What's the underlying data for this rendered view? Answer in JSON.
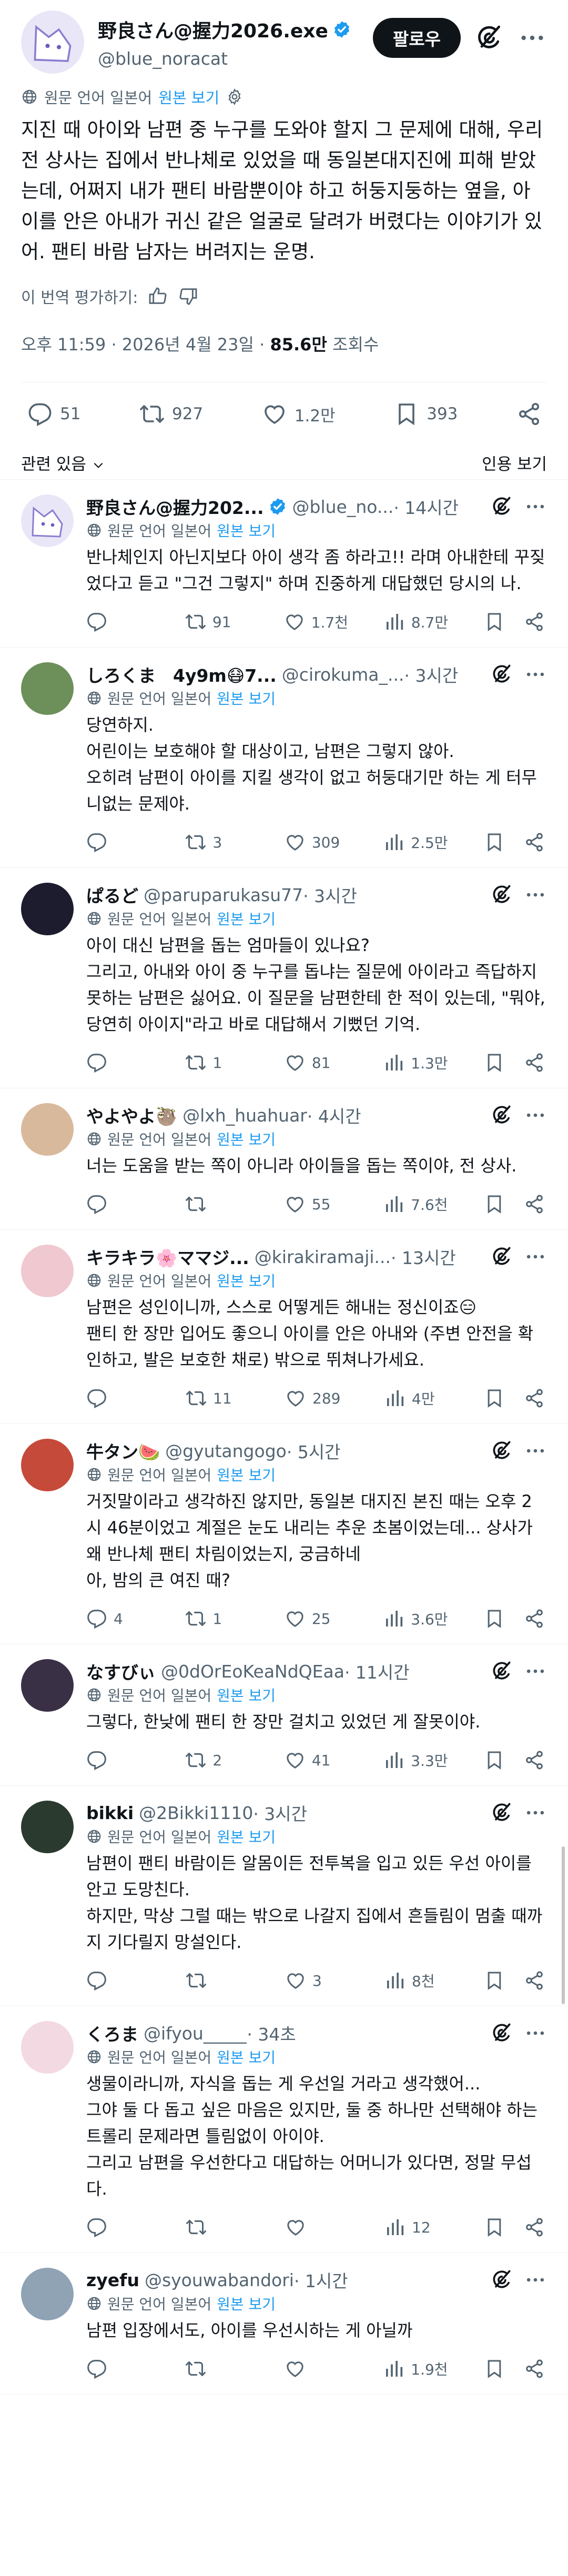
{
  "post": {
    "author_name": "野良さん@握力2026.exe",
    "handle": "@blue_noracat",
    "follow_label": "팔로우",
    "original_lang_label": "원문 언어 일본어",
    "view_original_label": "원본 보기",
    "text": "지진 때 아이와 남편 중 누구를 도와야 할지 그 문제에 대해, 우리 전 상사는 집에서 반나체로 있었을 때 동일본대지진에 피해 받았는데, 어쩌지 내가 팬티 바람뿐이야 하고 허둥지둥하는 옆을, 아이를 안은 아내가 귀신 같은 얼굴로 달려가 버렸다는 이야기가 있어. 팬티 바람 남자는 버려지는 운명.",
    "rate_label": "이 번역 평가하기:",
    "time": "오후 11:59 · 2026년 4월 23일 · ",
    "views": "85.6만",
    "views_label": " 조회수",
    "replies": "51",
    "reposts": "927",
    "likes": "1.2만",
    "bookmarks": "393",
    "relevance_label": "관련 있음",
    "quotes_label": "인용 보기"
  },
  "replies": [
    {
      "name": "野良さん@握力202...",
      "handle": "@blue_no...",
      "time": " · 14시간",
      "verified": true,
      "lang": "원문 언어 일본어",
      "view_original": "원본 보기",
      "text": "반나체인지 아닌지보다 아이 생각 좀 하라고!! 라며 아내한테 꾸짖었다고 듣고 \"그건 그렇지\" 하며 진중하게 대답했던 당시의 나.",
      "replies": "",
      "reposts": "91",
      "likes": "1.7천",
      "views": "8.7만"
    },
    {
      "name": "しろくま　4y9m😷7...",
      "handle": "@cirokuma_...",
      "time": " · 3시간",
      "lang": "원문 언어 일본어",
      "view_original": "원본 보기",
      "text": "당연하지.\n어린이는 보호해야 할 대상이고, 남편은 그렇지 않아.\n오히려 남편이 아이를 지킬 생각이 없고 허둥대기만 하는 게 터무니없는 문제야.",
      "replies": "",
      "reposts": "3",
      "likes": "309",
      "views": "2.5만"
    },
    {
      "name": "ぱるど",
      "handle": "@paruparukasu77",
      "time": " · 3시간",
      "lang": "원문 언어 일본어",
      "view_original": "원본 보기",
      "text": "아이 대신 남편을 돕는 엄마들이 있나요?\n그리고, 아내와 아이 중 누구를 돕냐는 질문에 아이라고 즉답하지 못하는 남편은 싫어요. 이 질문을 남편한테 한 적이 있는데, \"뭐야, 당연히 아이지\"라고 바로 대답해서 기뻤던 기억.",
      "replies": "",
      "reposts": "1",
      "likes": "81",
      "views": "1.3만"
    },
    {
      "name": "やよやよ🦥",
      "handle": "@lxh_huahuar",
      "time": " · 4시간",
      "lang": "원문 언어 일본어",
      "view_original": "원본 보기",
      "text": "너는 도움을 받는 쪽이 아니라 아이들을 돕는 쪽이야, 전 상사.",
      "replies": "",
      "reposts": "",
      "likes": "55",
      "views": "7.6천"
    },
    {
      "name": "キラキラ🌸ママジ...",
      "handle": "@kirakiramaji...",
      "time": " · 13시간",
      "lang": "원문 언어 일본어",
      "view_original": "원본 보기",
      "text": "남편은 성인이니까, 스스로 어떻게든 해내는 정신이죠😑\n팬티 한 장만 입어도 좋으니 아이를 안은 아내와 (주변 안전을 확인하고, 발은 보호한 채로) 밖으로 뛰쳐나가세요.",
      "replies": "",
      "reposts": "11",
      "likes": "289",
      "views": "4만"
    },
    {
      "name": "牛タン🍉",
      "handle": "@gyutangogo",
      "time": " · 5시간",
      "lang": "원문 언어 일본어",
      "view_original": "원본 보기",
      "text": "거짓말이라고 생각하진 않지만, 동일본 대지진 본진 때는 오후 2시 46분이었고 계절은 눈도 내리는 추운 초봄이었는데... 상사가 왜 반나체 팬티 차림이었는지, 궁금하네\n아, 밤의 큰 여진 때?",
      "replies": "4",
      "reposts": "1",
      "likes": "25",
      "views": "3.6만"
    },
    {
      "name": "なすびぃ",
      "handle": "@0dOrEoKeaNdQEaa",
      "time": " · 11시간",
      "lang": "원문 언어 일본어",
      "view_original": "원본 보기",
      "text": "그렇다, 한낮에 팬티 한 장만 걸치고 있었던 게 잘못이야.",
      "replies": "",
      "reposts": "2",
      "likes": "41",
      "views": "3.3만"
    },
    {
      "name": "bikki",
      "handle": "@2Bikki1110",
      "time": " · 3시간",
      "lang": "원문 언어 일본어",
      "view_original": "원본 보기",
      "text": "남편이 팬티 바람이든 알몸이든 전투복을 입고 있든 우선 아이를 안고 도망친다.\n하지만, 막상 그럴 때는 밖으로 나갈지 집에서 흔들림이 멈출 때까지 기다릴지 망설인다.",
      "replies": "",
      "reposts": "",
      "likes": "3",
      "views": "8천"
    },
    {
      "name": "くろま",
      "handle": "@ifyou_____",
      "time": " · 34초",
      "lang": "원문 언어 일본어",
      "view_original": "원본 보기",
      "text": "생물이라니까, 자식을 돕는 게 우선일 거라고 생각했어...\n그야 둘 다 돕고 싶은 마음은 있지만, 둘 중 하나만 선택해야 하는 트롤리 문제라면 틀림없이 아이야.\n그리고 남편을 우선한다고 대답하는 어머니가 있다면, 정말 무섭다.",
      "replies": "",
      "reposts": "",
      "likes": "",
      "views": "12"
    },
    {
      "name": "zyefu",
      "handle": "@syouwabandori",
      "time": " · 1시간",
      "lang": "원문 언어 일본어",
      "view_original": "원본 보기",
      "text": "남편 입장에서도, 아이를 우선시하는 게 아닐까",
      "replies": "",
      "reposts": "",
      "likes": "",
      "views": "1.9천"
    }
  ],
  "colors": {
    "accent": "#1d9bf0",
    "text": "#0f1419",
    "muted": "#536471",
    "avatar_bg": "#e9e6f7"
  }
}
